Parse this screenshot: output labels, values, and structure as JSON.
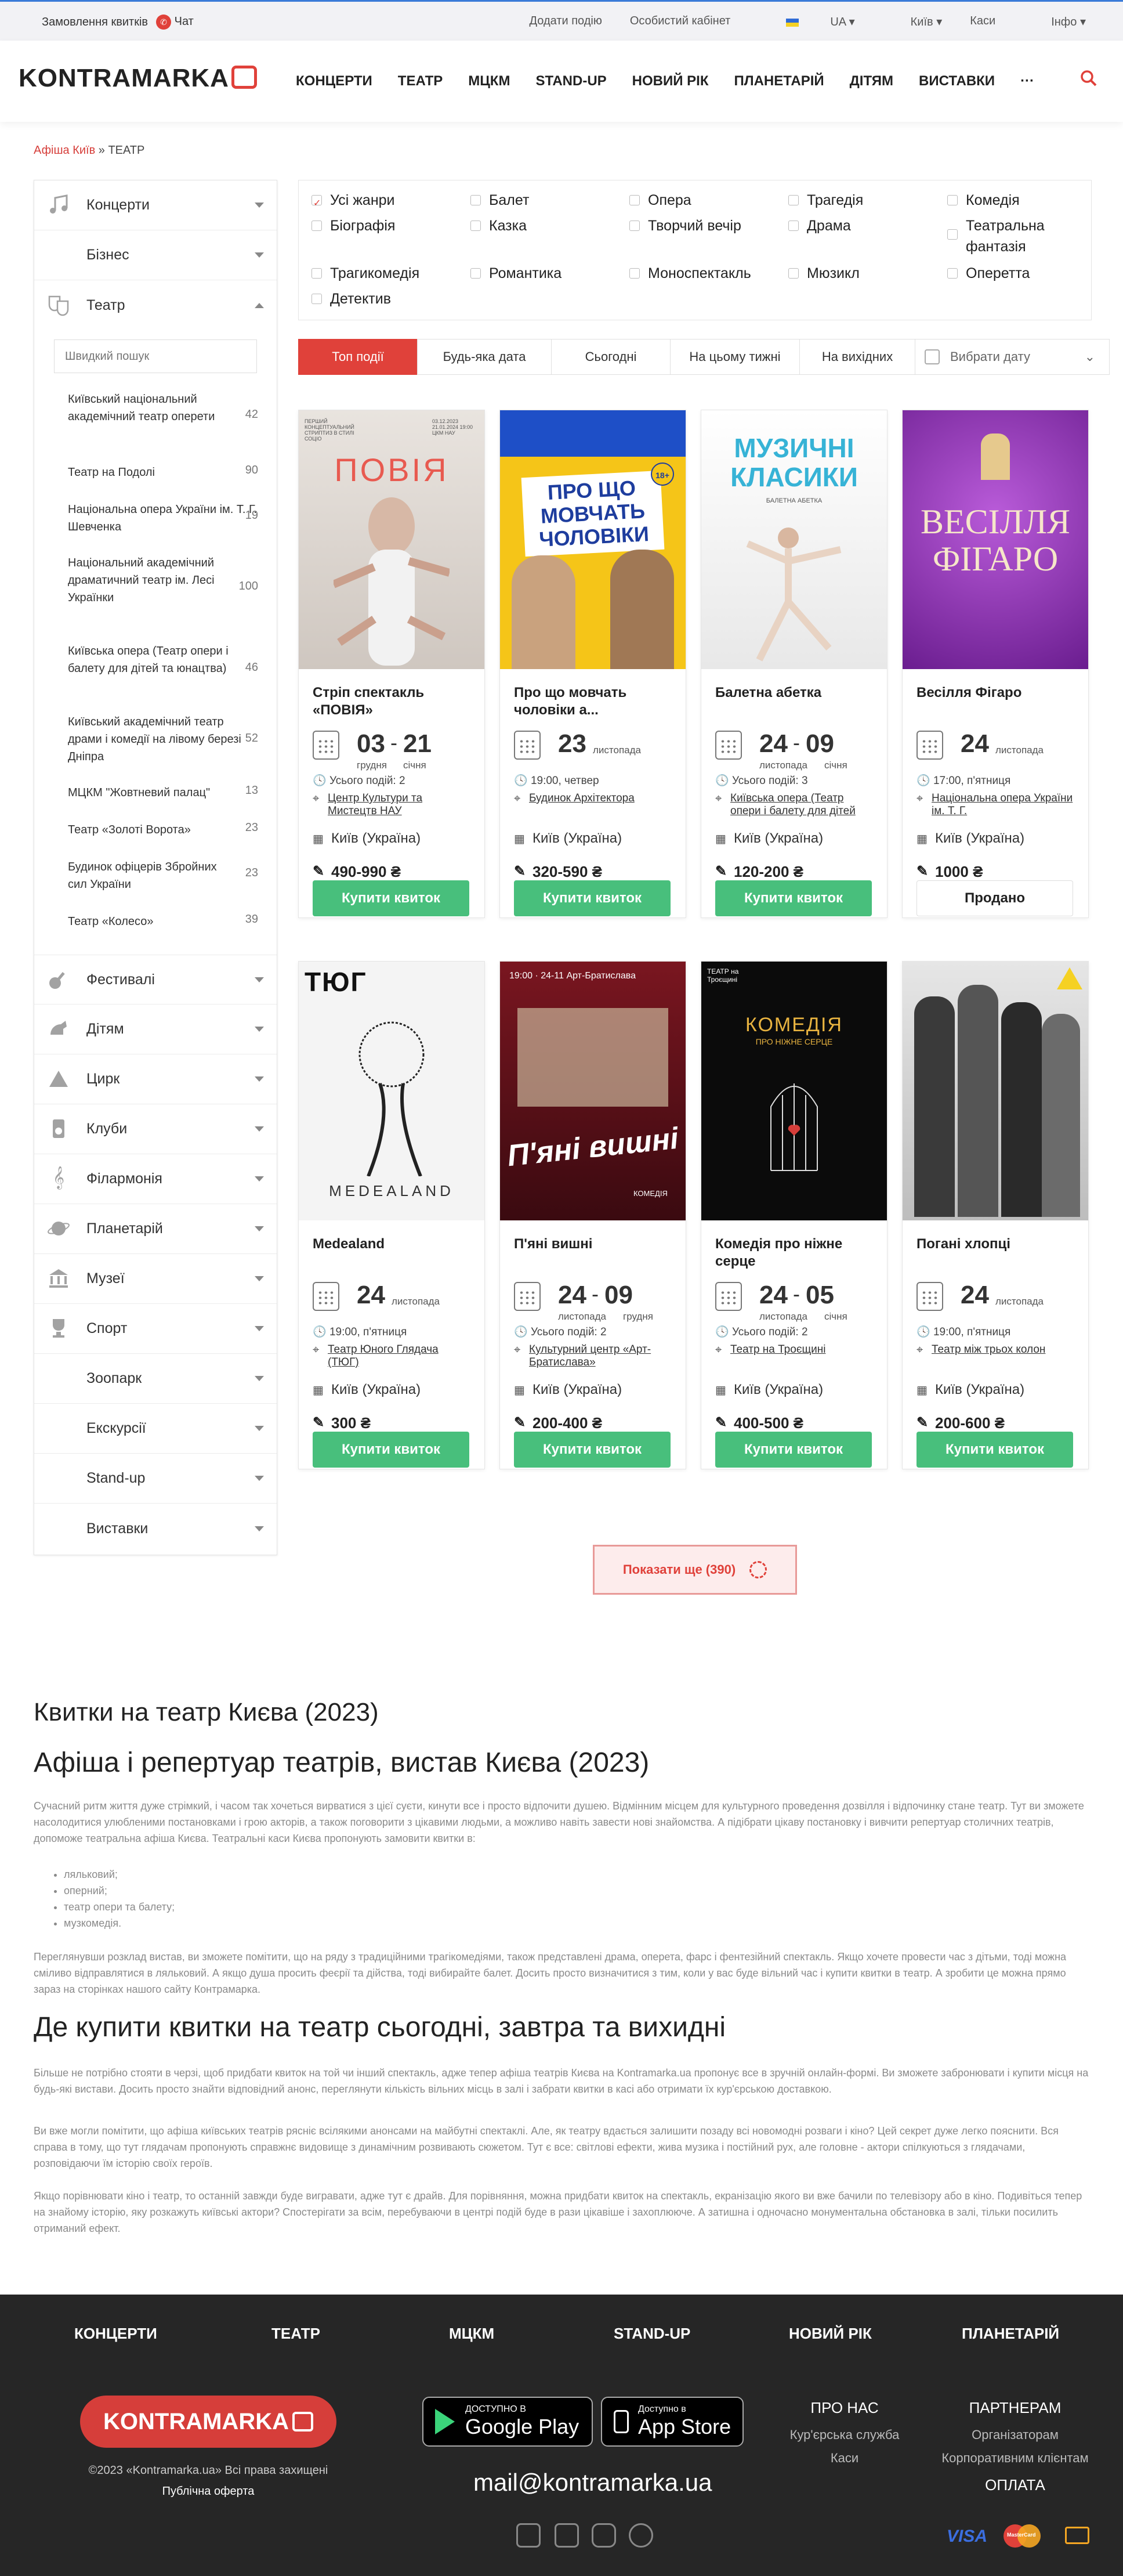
{
  "topbar": {
    "order": "Замовлення квитків",
    "chat": "Чат",
    "add": "Додати подію",
    "cabinet": "Особистий кабінет",
    "lang": "UA",
    "city": "Київ",
    "cashier": "Каси",
    "info": "Інфо"
  },
  "header": {
    "logo": "KONTRAMARKA",
    "nav": [
      "КОНЦЕРТИ",
      "ТЕАТР",
      "МЦКМ",
      "STAND-UP",
      "НОВИЙ РІК",
      "ПЛАНЕТАРІЙ",
      "ДІТЯМ",
      "ВИСТАВКИ",
      "···"
    ]
  },
  "breadcrumb": {
    "home": "Афіша Київ",
    "sep": "»",
    "current": "ТЕАТР"
  },
  "sidebar": {
    "search_placeholder": "Швидкий пошук",
    "top": [
      {
        "label": "Концерти",
        "icon": "music-note-icon"
      },
      {
        "label": "Бізнес"
      },
      {
        "label": "Театр",
        "icon": "theatre-masks-icon"
      }
    ],
    "venues": [
      {
        "name": "Київський національний академічний театр оперети",
        "count": "42"
      },
      {
        "name": "Театр на Подолі",
        "count": "90"
      },
      {
        "name": "Національна опера України ім. Т. Г. Шевченка",
        "count": "19"
      },
      {
        "name": "Національний академічний драматичний театр ім. Лесі Українки",
        "count": "100"
      },
      {
        "name": "Київська опера (Театр опери і балету для дітей та юнацтва)",
        "count": "46"
      },
      {
        "name": "Київський академічний театр драми і комедії на лівому березі Дніпра",
        "count": "52"
      },
      {
        "name": "МЦКМ \"Жовтневий палац\"",
        "count": "13"
      },
      {
        "name": "Театр «Золоті Ворота»",
        "count": "23"
      },
      {
        "name": "Будинок офіцерів Збройних сил України",
        "count": "23"
      },
      {
        "name": "Театр «Колесо»",
        "count": "39"
      }
    ],
    "bottom": [
      {
        "label": "Фестивалі",
        "icon": "guitar-icon"
      },
      {
        "label": "Дітям",
        "icon": "horse-icon"
      },
      {
        "label": "Цирк",
        "icon": "circus-icon"
      },
      {
        "label": "Клуби",
        "icon": "speaker-icon"
      },
      {
        "label": "Філармонія",
        "icon": "treble-clef-icon"
      },
      {
        "label": "Планетарій",
        "icon": "planet-icon"
      },
      {
        "label": "Музеї",
        "icon": "museum-icon"
      },
      {
        "label": "Спорт",
        "icon": "trophy-icon"
      },
      {
        "label": "Зоопарк"
      },
      {
        "label": "Екскурсії"
      },
      {
        "label": "Stand-up"
      },
      {
        "label": "Виставки"
      }
    ]
  },
  "genres": [
    "Усі жанри",
    "Балет",
    "Опера",
    "Трагедія",
    "Комедія",
    "Біографія",
    "Казка",
    "Творчий вечір",
    "Драма",
    "Театральна фантазія",
    "Трагикомедія",
    "Романтика",
    "Моноспектакль",
    "Мюзикл",
    "Оперетта",
    "Детектив"
  ],
  "tabs": [
    "Топ події",
    "Будь-яка дата",
    "Сьогодні",
    "На цьому тижні",
    "На вихідних",
    "Вибрати дату"
  ],
  "cards": [
    {
      "title": "Стріп спектакль «ПОВІЯ»",
      "day1": "03",
      "day2": "21",
      "m1": "грудня",
      "m2": "січня",
      "info": "Усього подій: 2",
      "venue": "Центр Культури та Мистецтв НАУ",
      "city": "Київ (Україна)",
      "price": "490-990 ₴",
      "btn": "Купити квиток",
      "poster_text": "ПОВІЯ",
      "poster_sub": "ПЕРШИЙ КОНЦЕПТУАЛЬНИЙ СТРИПТИЗ В СТИЛІ СОЦІО",
      "poster_dates": "03.12.2023 21.01.2024 19:00 ЦКМ НАУ"
    },
    {
      "title": "Про що мовчать чоловіки а...",
      "day1": "23",
      "m1": "листопада",
      "info": "19:00, четвер",
      "venue": "Будинок Архітектора",
      "city": "Київ (Україна)",
      "price": "320-590 ₴",
      "btn": "Купити квиток",
      "poster_text": "ПРО ЩО МОВЧАТЬ ЧОЛОВІКИ",
      "poster_sub": "18+"
    },
    {
      "title": "Балетна абетка",
      "day1": "24",
      "day2": "09",
      "m1": "листопада",
      "m2": "січня",
      "info": "Усього подій: 3",
      "venue": "Київська опера (Театр опери і балету для дітей",
      "city": "Київ (Україна)",
      "price": "120-200 ₴",
      "btn": "Купити квиток",
      "poster_text": "МУЗИЧНІ КЛАСИКИ",
      "poster_sub": "БАЛЕТНА АБЕТКА"
    },
    {
      "title": "Весілля Фігаро",
      "day1": "24",
      "m1": "листопада",
      "info": "17:00, п'ятниця",
      "venue": "Національна опера України ім. Т. Г.",
      "city": "Київ (Україна)",
      "price": "1000 ₴",
      "btn": "Продано",
      "poster_text": "ВЕСІЛЛЯ ФІГАРО"
    },
    {
      "title": "Medealand",
      "day1": "24",
      "m1": "листопада",
      "info": "19:00, п'ятниця",
      "venue": "Театр Юного Глядача (ТЮГ)",
      "city": "Київ (Україна)",
      "price": "300 ₴",
      "btn": "Купити квиток",
      "poster_text": "MEDEALAND",
      "poster_sub": "ТЮГ"
    },
    {
      "title": "П'яні вишні",
      "day1": "24",
      "day2": "09",
      "m1": "листопада",
      "m2": "грудня",
      "info": "Усього подій: 2",
      "venue": "Культурний центр «Арт-Братислава»",
      "city": "Київ (Україна)",
      "price": "200-400 ₴",
      "btn": "Купити квиток",
      "poster_text": "П'яні вишні",
      "poster_sub": "19:00 · 24-11   Арт-Братислава",
      "poster_sub2": "КОМЕДІЯ"
    },
    {
      "title": "Комедія про ніжне серце",
      "day1": "24",
      "day2": "05",
      "m1": "листопада",
      "m2": "січня",
      "info": "Усього подій: 2",
      "venue": "Театр на Троєщині",
      "city": "Київ (Україна)",
      "price": "400-500 ₴",
      "btn": "Купити квиток",
      "poster_text": "КОМЕДІЯ",
      "poster_sub": "ПРО НІЖНЕ СЕРЦЕ",
      "poster_sub2": "ТЕАТР на Троєщині"
    },
    {
      "title": "Погані хлопці",
      "day1": "24",
      "m1": "листопада",
      "info": "19:00, п'ятниця",
      "venue": "Театр між трьох колон",
      "city": "Київ (Україна)",
      "price": "200-600 ₴",
      "btn": "Купити квиток"
    }
  ],
  "more": "Показати ще (390)",
  "seo": {
    "h1": "Квитки на театр Києва (2023)",
    "h2": "Афіша і репертуар театрів, вистав Києва (2023)",
    "p1": "Сучасний ритм життя дуже стрімкий, і часом так хочеться вирватися з цієї суєти, кинути все і просто відпочити душею. Відмінним місцем для культурного проведення дозвілля і відпочинку стане театр. Тут ви зможете насолодитися улюбленими постановками і грою акторів, а також поговорити з цікавими людьми, а можливо навіть завести нові знайомства. А підібрати цікаву постановку і вивчити репертуар столичних театрів, допоможе театральна афіша Києва. Театральні каси Києва пропонують замовити квитки в:",
    "list": [
      "ляльковий;",
      "оперний;",
      "театр опери та балету;",
      "музкомедія."
    ],
    "p2": "Переглянувши розклад вистав, ви зможете помітити, що на ряду з традиційними трагікомедіями, також представлені драма, оперета, фарс і фентезійний спектакль. Якщо хочете провести час з дітьми, тоді можна сміливо відправлятися в ляльковий. А якщо душа просить феєрії та дійства, тоді вибирайте балет. Досить просто визначитися з тим, коли у вас буде вільний час і купити квитки в театр. А зробити це можна прямо зараз на сторінках нашого сайту Контрамарка.",
    "h3": "Де купити квитки на театр сьогодні, завтра та вихидні",
    "p3": "Більше не потрібно стояти в черзі, щоб придбати квиток на той чи інший спектакль, адже тепер афіша театрів Києва на Kontramarka.ua пропонує все в зручній онлайн-формі. Ви зможете забронювати і купити місця на будь-які вистави. Досить просто знайти відповідний анонс, переглянути кількість вільних місць в залі і забрати квитки в касі або отримати їх кур'єрською доставкою.",
    "p4": "Ви вже могли помітити, що афіша київських театрів рясніє всілякими анонсами на майбутні спектаклі. Але, як театру вдається залишити позаду всі новомодні розваги і кіно? Цей секрет дуже легко пояснити. Вся справа в тому, що тут глядачам пропонують справжнє видовище з динамічним розвивають сюжетом. Тут є все: світлові ефекти, жива музика і постійний рух, але головне - актори спілкуються з глядачами, розповідаючи їм історію своїх героїв.",
    "p5": "Якщо порівнювати кіно і театр, то останній завжди буде вигравати, адже тут є драйв. Для порівняння, можна придбати квиток на спектакль, екранізацію якого ви вже бачили по телевізору або в кіно. Подивіться тепер на знайому історію, яку розкажуть київські актори? Спостерігати за всім, перебуваючи в центрі подій буде в рази цікавіше і захоплююче. А затишна і одночасно монументальна обстановка в залі, тільки посилить отриманий ефект."
  },
  "footer": {
    "nav": [
      "КОНЦЕРТИ",
      "ТЕАТР",
      "МЦКМ",
      "STAND-UP",
      "НОВИЙ РІК",
      "ПЛАНЕТАРІЙ"
    ],
    "logo": "KONTRAMARKA",
    "copyright": "©2023 «Kontramarka.ua» Всі права захищені",
    "offer": "Публічна оферта",
    "gplay_small": "ДОСТУПНО В",
    "gplay": "Google Play",
    "appstore_small": "Доступно в",
    "appstore": "App Store",
    "about": {
      "h": "ПРО НАС",
      "items": [
        "Кур'єрська служба",
        "Каси"
      ]
    },
    "partners": {
      "h": "ПАРТНЕРАМ",
      "items": [
        "Організаторам",
        "Корпоративним клієнтам"
      ]
    },
    "pay": "ОПЛАТА",
    "email": "mail@kontramarka.ua",
    "visa": "VISA",
    "mc": "MasterCard"
  },
  "colors": {
    "accent": "#e0413a",
    "buy": "#48bf7c",
    "footer": "#262626"
  }
}
